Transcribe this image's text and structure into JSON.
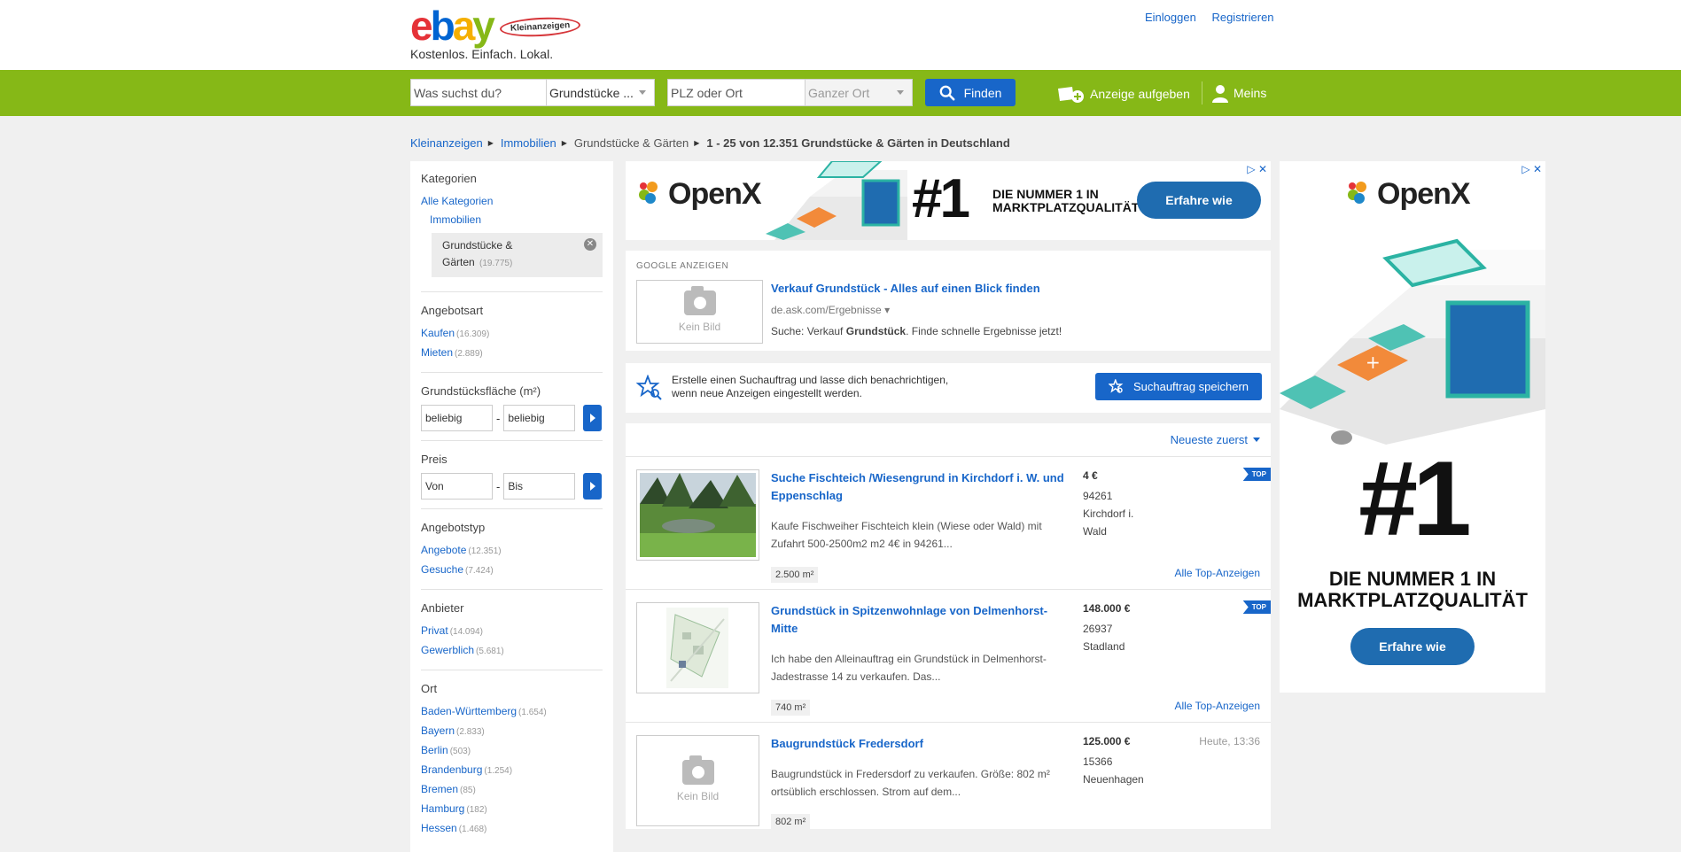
{
  "header": {
    "logo_letters": [
      "e",
      "b",
      "a",
      "y"
    ],
    "logo_badge": "Kleinanzeigen",
    "tagline": "Kostenlos. Einfach. Lokal.",
    "login": "Einloggen",
    "register": "Registrieren"
  },
  "search": {
    "query_placeholder": "Was suchst du?",
    "category": "Grundstücke ...",
    "location_placeholder": "PLZ oder Ort",
    "radius": "Ganzer Ort",
    "find": "Finden",
    "post_ad": "Anzeige aufgeben",
    "meins": "Meins"
  },
  "breadcrumb": {
    "items": [
      "Kleinanzeigen",
      "Immobilien"
    ],
    "current": "Grundstücke & Gärten",
    "summary": "1 - 25 von 12.351 Grundstücke & Gärten in Deutschland"
  },
  "sidebar": {
    "categories": {
      "title": "Kategorien",
      "all": "Alle Kategorien",
      "parent": "Immobilien",
      "active_label": "Grundstücke &",
      "active_label2": "Gärten",
      "active_count": "(19.775)"
    },
    "offer_type": {
      "title": "Angebotsart",
      "items": [
        {
          "label": "Kaufen",
          "count": "(16.309)"
        },
        {
          "label": "Mieten",
          "count": "(2.889)"
        }
      ]
    },
    "area": {
      "title": "Grundstücksfläche (m²)",
      "from": "beliebig",
      "to": "beliebig",
      "dash": "-"
    },
    "price": {
      "title": "Preis",
      "from": "Von",
      "to": "Bis",
      "dash": "-"
    },
    "listing_type": {
      "title": "Angebotstyp",
      "items": [
        {
          "label": "Angebote",
          "count": "(12.351)"
        },
        {
          "label": "Gesuche",
          "count": "(7.424)"
        }
      ]
    },
    "seller": {
      "title": "Anbieter",
      "items": [
        {
          "label": "Privat",
          "count": "(14.094)"
        },
        {
          "label": "Gewerblich",
          "count": "(5.681)"
        }
      ]
    },
    "location": {
      "title": "Ort",
      "items": [
        {
          "label": "Baden-Württemberg",
          "count": "(1.654)"
        },
        {
          "label": "Bayern",
          "count": "(2.833)"
        },
        {
          "label": "Berlin",
          "count": "(503)"
        },
        {
          "label": "Brandenburg",
          "count": "(1.254)"
        },
        {
          "label": "Bremen",
          "count": "(85)"
        },
        {
          "label": "Hamburg",
          "count": "(182)"
        },
        {
          "label": "Hessen",
          "count": "(1.468)"
        }
      ]
    }
  },
  "ad_banner": {
    "brand": "OpenX",
    "headline": "#1",
    "line1": "DIE NUMMER 1 IN",
    "line2": "MARKTPLATZQUALITÄT",
    "cta": "Erfahre wie"
  },
  "google_ads": {
    "label": "GOOGLE ANZEIGEN",
    "no_image": "Kein Bild",
    "title": "Verkauf Grundstück - Alles auf einen Blick finden",
    "url": "de.ask.com/Ergebnisse ▾",
    "desc_prefix": "Suche: Verkauf ",
    "desc_bold": "Grundstück",
    "desc_suffix": ". Finde schnelle Ergebnisse jetzt!"
  },
  "save_search": {
    "line1": "Erstelle einen Suchauftrag und lasse dich benachrichtigen,",
    "line2": "wenn neue Anzeigen eingestellt werden.",
    "button": "Suchauftrag speichern"
  },
  "sort": {
    "label": "Neueste zuerst"
  },
  "listings": [
    {
      "title": "Suche Fischteich /Wiesengrund in Kirchdorf i. W. und Eppenschlag",
      "desc": "Kaufe Fischweiher Fischteich klein (Wiese oder Wald) mit Zufahrt 500-2500m2 m2 4€ in 94261...",
      "tag": "2.500 m²",
      "price": "4 €",
      "zip": "94261",
      "city": "Kirchdorf i. Wald",
      "badge": "TOP",
      "all_top": "Alle Top-Anzeigen"
    },
    {
      "title": "Grundstück in Spitzenwohnlage von Delmenhorst-Mitte",
      "desc": "Ich habe den Alleinauftrag ein Grundstück in Delmenhorst-Jadestrasse 14 zu verkaufen. Das...",
      "tag": "740 m²",
      "price": "148.000 €",
      "zip": "26937",
      "city": "Stadland",
      "badge": "TOP",
      "all_top": "Alle Top-Anzeigen"
    },
    {
      "title": "Baugrundstück Fredersdorf",
      "desc": "Baugrundstück in Fredersdorf zu verkaufen. Größe: 802 m² ortsüblich erschlossen. Strom auf dem...",
      "tag": "802 m²",
      "price": "125.000 €",
      "zip": "15366",
      "city": "Neuenhagen",
      "date": "Heute, 13:36",
      "no_image": "Kein Bild"
    }
  ],
  "colors": {
    "brand_green": "#86b817",
    "link_blue": "#1866c9",
    "ad_blue": "#1f6cb0"
  }
}
